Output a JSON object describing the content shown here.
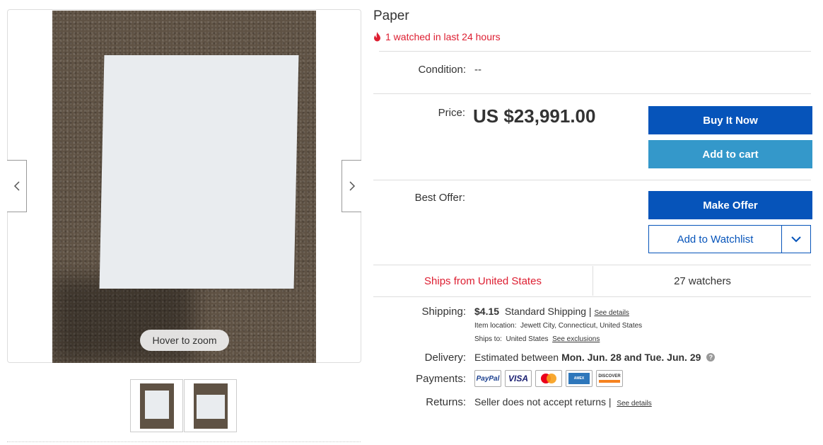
{
  "gallery": {
    "hover_zoom": "Hover to zoom",
    "prev_icon": "chevron-left-icon",
    "next_icon": "chevron-right-icon",
    "thumbnail_count": 2
  },
  "item": {
    "title": "Paper",
    "watched_text": "1 watched in last 24 hours",
    "condition_label": "Condition:",
    "condition_value": "--",
    "price_label": "Price:",
    "price_value": "US $23,991.00",
    "best_offer_label": "Best Offer:"
  },
  "buttons": {
    "buy_now": "Buy It Now",
    "add_to_cart": "Add to cart",
    "make_offer": "Make Offer",
    "add_to_watchlist": "Add to Watchlist"
  },
  "info_bar": {
    "ships_from": "Ships from United States",
    "watchers": "27 watchers"
  },
  "shipping": {
    "label": "Shipping:",
    "price": "$4.15",
    "method": "Standard Shipping |",
    "details_link": "See details",
    "item_location_label": "Item location:",
    "item_location": "Jewett City, Connecticut, United States",
    "ships_to_label": "Ships to:",
    "ships_to": "United States",
    "exclusions_link": "See exclusions"
  },
  "delivery": {
    "label": "Delivery:",
    "prefix": "Estimated between",
    "range": "Mon. Jun. 28 and Tue. Jun. 29"
  },
  "payments": {
    "label": "Payments:",
    "methods": [
      "PayPal",
      "VISA",
      "Mastercard",
      "American Express",
      "Discover"
    ]
  },
  "returns": {
    "label": "Returns:",
    "text": "Seller does not accept returns |",
    "details_link": "See details"
  },
  "colors": {
    "primary_blue": "#0654ba",
    "light_blue": "#3498ca",
    "alert_red": "#dd1e31"
  }
}
